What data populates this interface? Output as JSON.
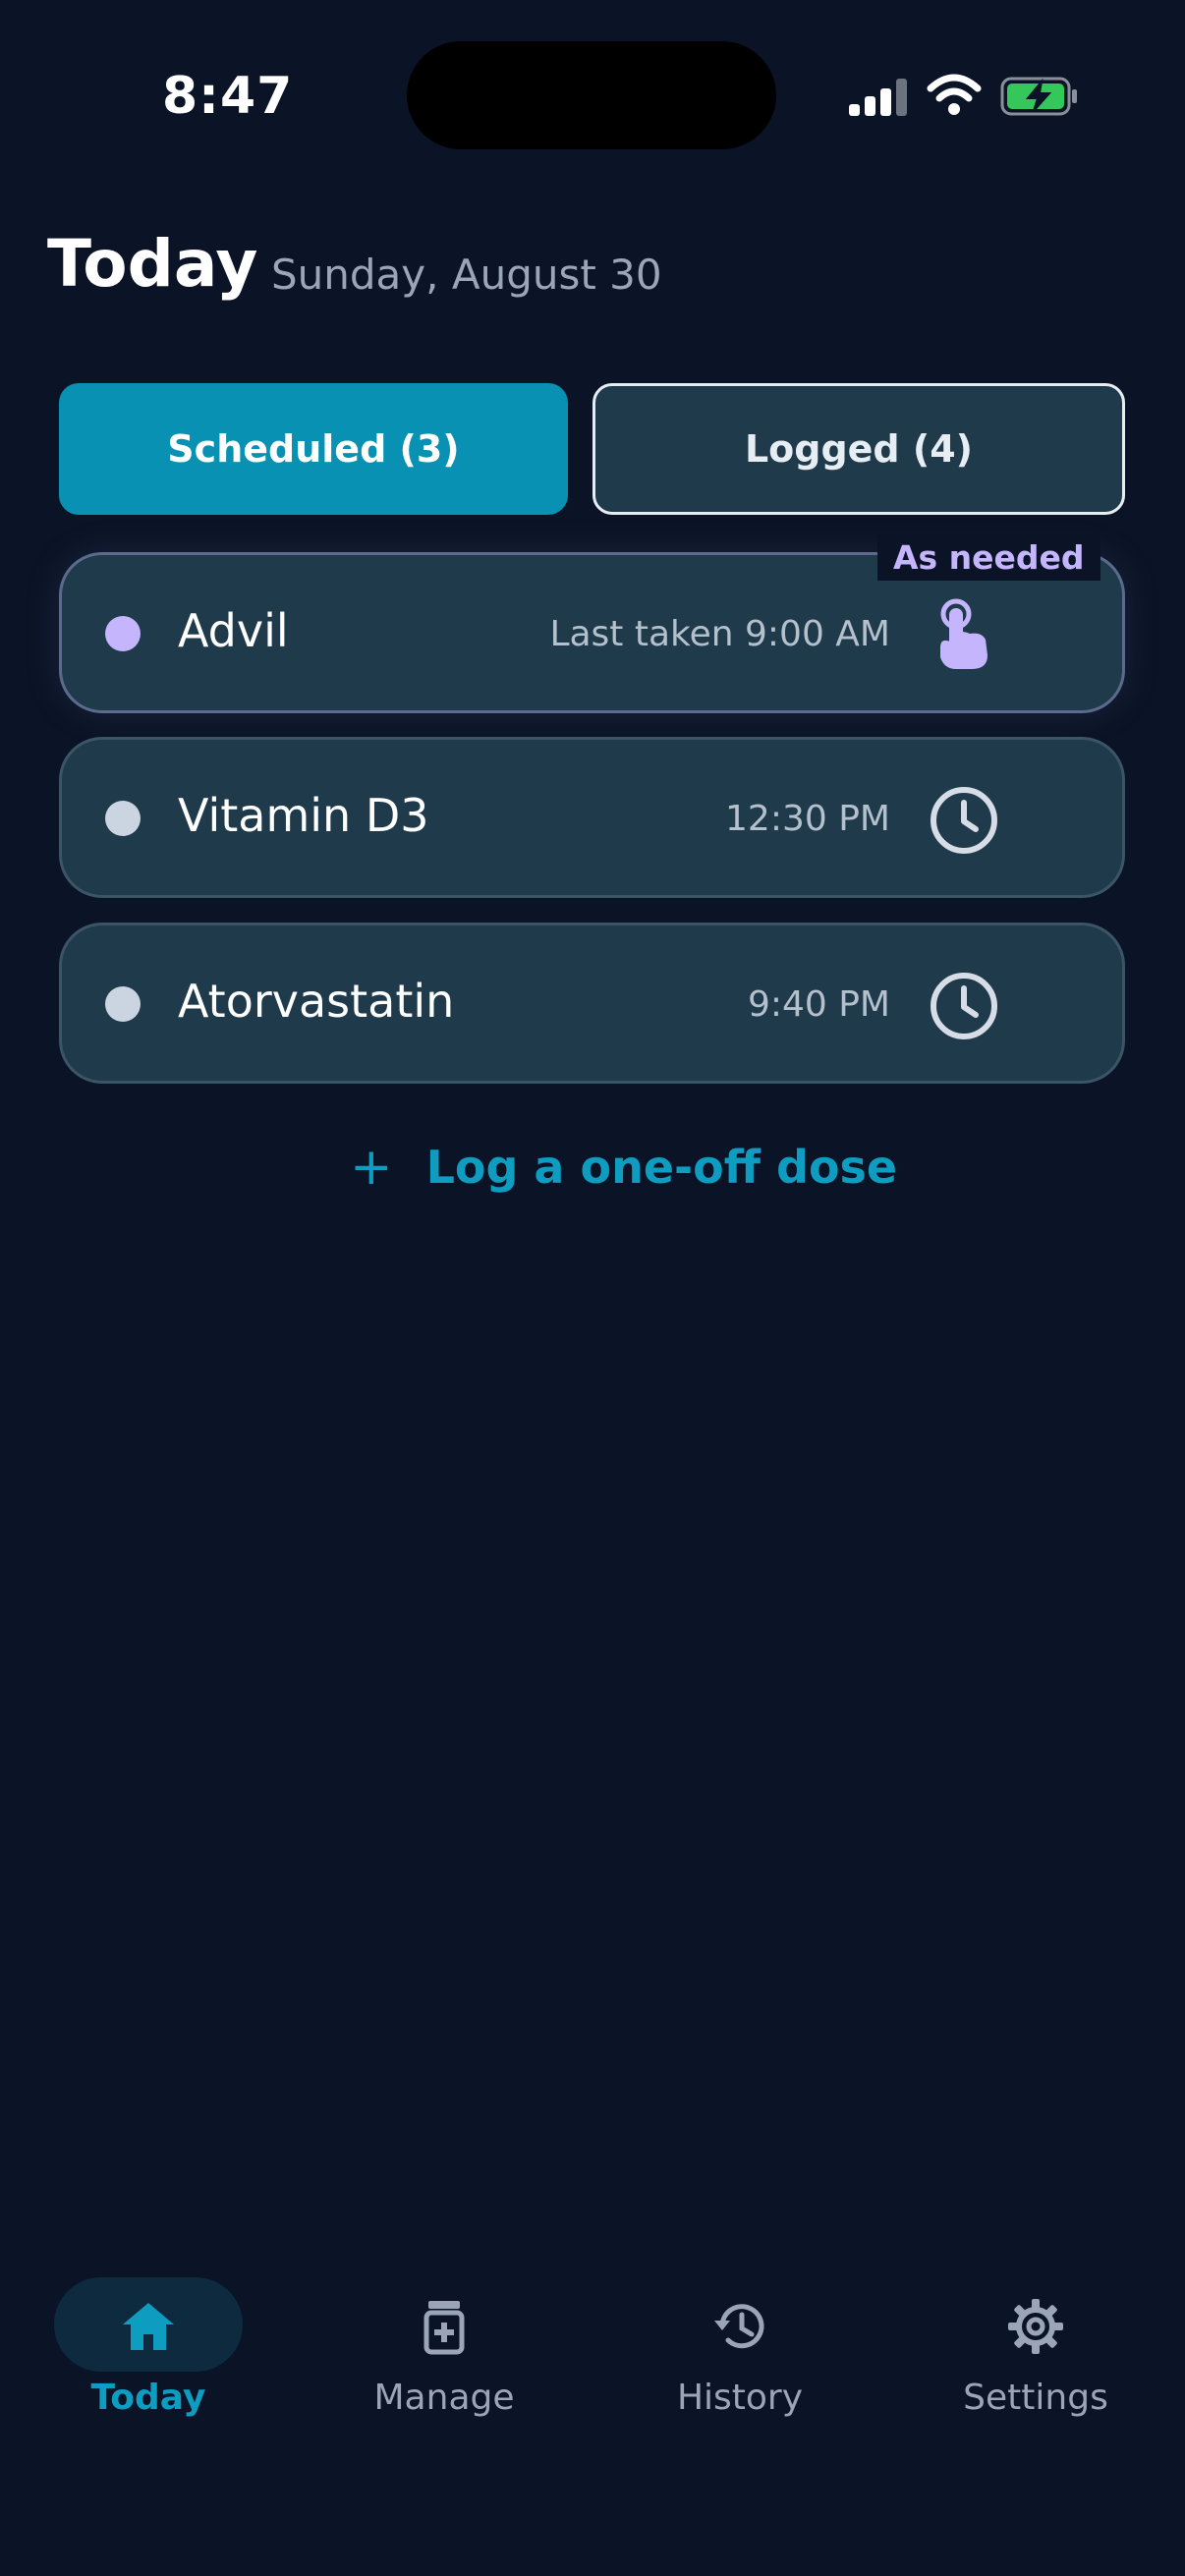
{
  "status_bar": {
    "time": "8:47"
  },
  "header": {
    "title": "Today",
    "date": "Sunday, August 30"
  },
  "tabs": [
    {
      "label": "Scheduled (3)",
      "active": true
    },
    {
      "label": "Logged (4)",
      "active": false
    }
  ],
  "medications": [
    {
      "name": "Advil",
      "time": "Last taken 9:00 AM",
      "badge": "As needed",
      "dot_color": "#c4b5fd",
      "icon": "tap-hand-icon"
    },
    {
      "name": "Vitamin D3",
      "time": "12:30 PM",
      "dot_color": "#cbd5e1",
      "icon": "clock-icon"
    },
    {
      "name": "Atorvastatin",
      "time": "9:40 PM",
      "dot_color": "#cbd5e1",
      "icon": "clock-icon"
    }
  ],
  "actions": {
    "log_one_off": "Log a one-off dose"
  },
  "nav": [
    {
      "label": "Today",
      "icon": "home-icon",
      "active": true
    },
    {
      "label": "Manage",
      "icon": "pill-bottle-icon",
      "active": false
    },
    {
      "label": "History",
      "icon": "history-icon",
      "active": false
    },
    {
      "label": "Settings",
      "icon": "gear-icon",
      "active": false
    }
  ],
  "colors": {
    "background": "#0b1426",
    "accent": "#0891b2",
    "card": "#1f3a4b",
    "as_needed": "#c4b5fd"
  }
}
